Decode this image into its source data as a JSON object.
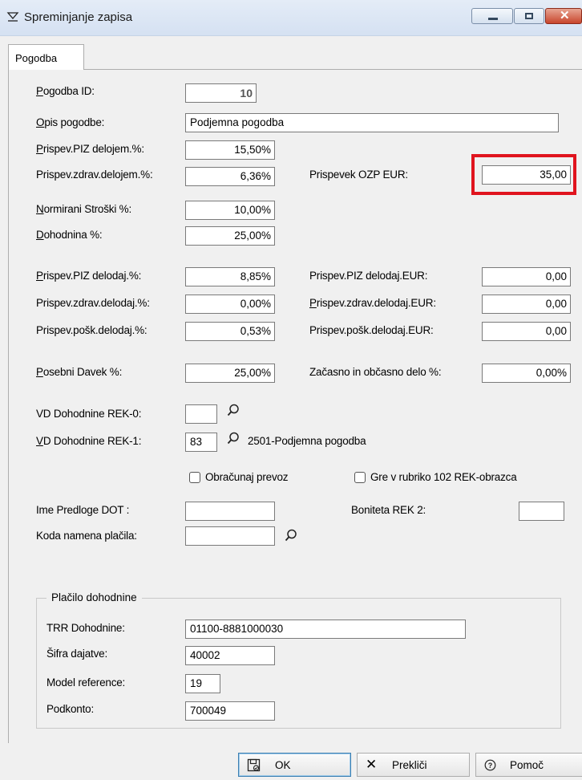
{
  "window": {
    "title": "Spreminjanje zapisa",
    "icon": "filter-icon"
  },
  "tab": {
    "label": "Pogodba"
  },
  "fields": {
    "pogodba_id": {
      "label_u": "P",
      "label_rest": "ogodba  ID:",
      "value": "10"
    },
    "opis": {
      "label_u": "O",
      "label_rest": "pis pogodbe:",
      "value": "Podjemna pogodba"
    },
    "piz_delojem": {
      "label_u": "P",
      "label_rest": "rispev.PIZ delojem.%:",
      "value": "15,50%"
    },
    "zdrav_delojem": {
      "label": "Prispev.zdrav.delojem.%:",
      "value": "6,36%"
    },
    "ozp": {
      "label": "Prispevek OZP EUR:",
      "value": "35,00"
    },
    "normirani": {
      "label_u": "N",
      "label_rest": "ormirani Stroški %:",
      "value": "10,00%"
    },
    "dohodnina": {
      "label_u": "D",
      "label_rest": "ohodnina %:",
      "value": "25,00%"
    },
    "piz_delodaj": {
      "label_u": "P",
      "label_rest": "rispev.PIZ delodaj.%:",
      "value": "8,85%"
    },
    "piz_delodaj_eur": {
      "label": "Prispev.PIZ delodaj.EUR:",
      "value": "0,00"
    },
    "zdrav_delodaj": {
      "label": "Prispev.zdrav.delodaj.%:",
      "value": "0,00%"
    },
    "zdrav_delodaj_eur": {
      "label_u": "P",
      "label_rest": "rispev.zdrav.delodaj.EUR:",
      "value": "0,00"
    },
    "posk_delodaj": {
      "label": "Prispev.pošk.delodaj.%:",
      "value": "0,53%"
    },
    "posk_delodaj_eur": {
      "label": "Prispev.pošk.delodaj.EUR:",
      "value": "0,00"
    },
    "posebni": {
      "label_u": "P",
      "label_rest": "osebni Davek %:",
      "value": "25,00%"
    },
    "zacasno": {
      "label": "Začasno in občasno delo %:",
      "value": "0,00%"
    },
    "vd_rek0": {
      "label": "VD Dohodnine REK-0:",
      "value": ""
    },
    "vd_rek1": {
      "label_u": "V",
      "label_rest": "D Dohodnine REK-1:",
      "value": "83",
      "desc": "2501-Podjemna pogodba"
    },
    "obracunaj": {
      "label": "Obračunaj prevoz",
      "checked": false
    },
    "rubrika": {
      "label": "Gre v rubriko 102 REK-obrazca",
      "checked": false
    },
    "ime_predloge": {
      "label": "Ime Predloge DOT :",
      "value": ""
    },
    "boniteta": {
      "label": "Boniteta REK 2:",
      "value": ""
    },
    "koda": {
      "label": "Koda namena plačila:",
      "value": ""
    }
  },
  "placilo": {
    "legend": "Plačilo dohodnine",
    "trr": {
      "label": "TRR Dohodnine:",
      "value": "01100-8881000030"
    },
    "sifra": {
      "label": "Šifra dajatve:",
      "value": "40002"
    },
    "model": {
      "label": "Model reference:",
      "value": "19"
    },
    "podkonto": {
      "label": "Podkonto:",
      "value": "700049"
    }
  },
  "buttons": {
    "ok": {
      "label": "OK",
      "icon": "save-icon"
    },
    "preklici": {
      "label": "Prekliči",
      "icon": "close-icon"
    },
    "pomoc": {
      "label": "Pomoč",
      "icon": "help-icon"
    }
  },
  "colors": {
    "highlight": "#e0141e"
  }
}
